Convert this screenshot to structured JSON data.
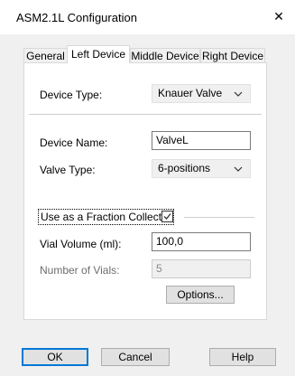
{
  "window": {
    "title": "ASM2.1L Configuration",
    "close_glyph": "✕"
  },
  "tabs": [
    {
      "label": "General"
    },
    {
      "label": "Left Device"
    },
    {
      "label": "Middle Device"
    },
    {
      "label": "Right Device"
    }
  ],
  "form": {
    "device_type_label": "Device Type:",
    "device_type_value": "Knauer Valve",
    "device_name_label": "Device Name:",
    "device_name_value": "ValveL",
    "valve_type_label": "Valve Type:",
    "valve_type_value": "6-positions",
    "fraction_collector_label": "Use as a Fraction Collector",
    "fraction_collector_checked": true,
    "vial_volume_label": "Vial Volume (ml):",
    "vial_volume_value": "100,0",
    "number_of_vials_label": "Number of Vials:",
    "number_of_vials_value": "5",
    "options_label": "Options..."
  },
  "buttons": {
    "ok": "OK",
    "cancel": "Cancel",
    "help": "Help"
  },
  "icons": {
    "dropdown": "chevron-down-icon",
    "check": "checkmark-icon"
  }
}
